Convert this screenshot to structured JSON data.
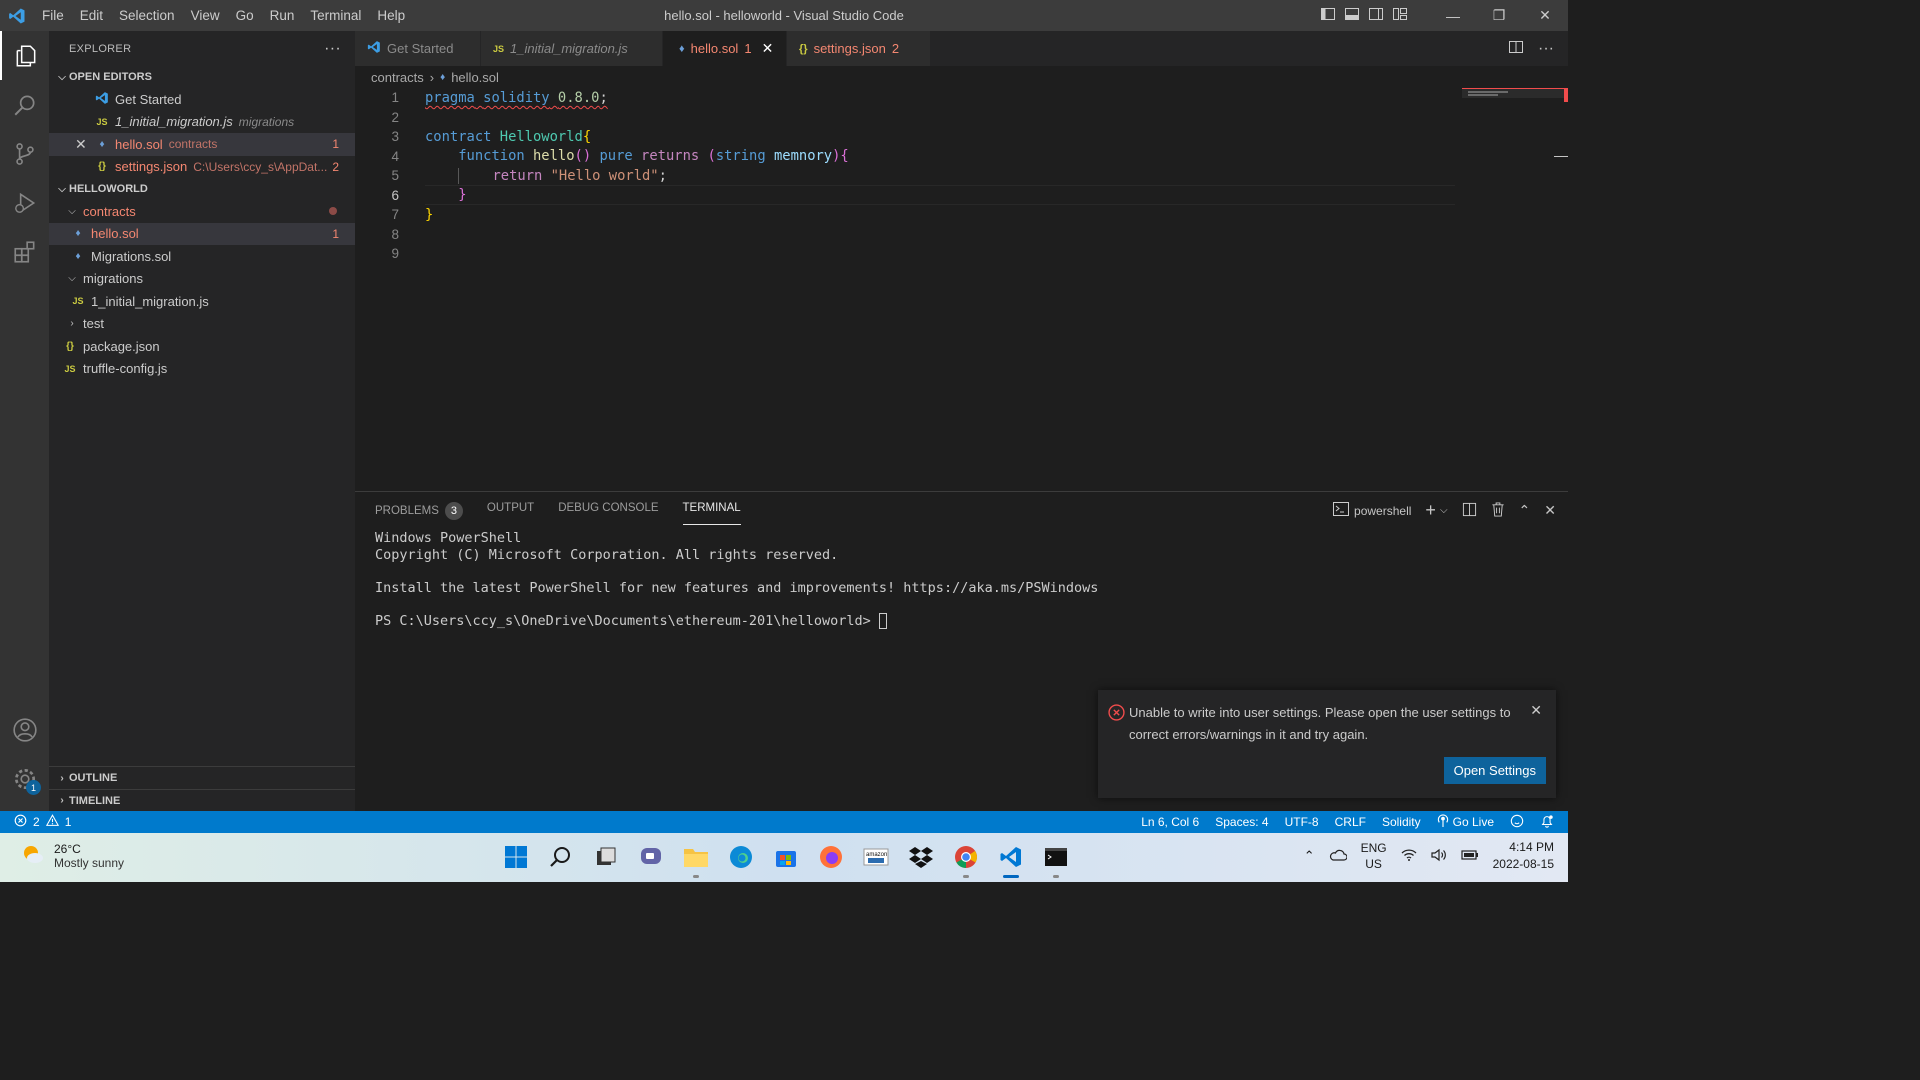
{
  "titlebar": {
    "menu": [
      "File",
      "Edit",
      "Selection",
      "View",
      "Go",
      "Run",
      "Terminal",
      "Help"
    ],
    "title": "hello.sol - helloworld - Visual Studio Code"
  },
  "sidebar": {
    "header": "EXPLORER",
    "open_editors_label": "OPEN EDITORS",
    "open_editors": [
      {
        "icon": "vscode-icon",
        "name": "Get Started",
        "desc": "",
        "count": ""
      },
      {
        "icon": "js-icon",
        "name": "1_initial_migration.js",
        "desc": "migrations",
        "count": ""
      },
      {
        "icon": "solidity-icon",
        "name": "hello.sol",
        "desc": "contracts",
        "count": "1"
      },
      {
        "icon": "json-icon",
        "name": "settings.json",
        "desc": "C:\\Users\\ccy_s\\AppDat...",
        "count": "2"
      }
    ],
    "project_label": "HELLOWORLD",
    "tree": [
      {
        "name": "contracts",
        "type": "folder"
      },
      {
        "name": "hello.sol",
        "type": "file",
        "count": "1"
      },
      {
        "name": "Migrations.sol",
        "type": "file"
      },
      {
        "name": "migrations",
        "type": "folder"
      },
      {
        "name": "1_initial_migration.js",
        "type": "file"
      },
      {
        "name": "test",
        "type": "folder"
      },
      {
        "name": "package.json",
        "type": "file"
      },
      {
        "name": "truffle-config.js",
        "type": "file"
      }
    ],
    "outline_label": "OUTLINE",
    "timeline_label": "TIMELINE"
  },
  "tabs": [
    {
      "label": "Get Started",
      "icon": "vscode-icon",
      "count": ""
    },
    {
      "label": "1_initial_migration.js",
      "icon": "js-icon",
      "count": ""
    },
    {
      "label": "hello.sol",
      "icon": "solidity-icon",
      "count": "1"
    },
    {
      "label": "settings.json",
      "icon": "json-icon",
      "count": "2"
    }
  ],
  "breadcrumb": {
    "folder": "contracts",
    "file": "hello.sol"
  },
  "editor": {
    "line_numbers": [
      "1",
      "2",
      "3",
      "4",
      "5",
      "6",
      "7",
      "8",
      "9"
    ],
    "lines": [
      "pragma solidity 0.8.0;",
      "",
      "contract Helloworld{",
      "    function hello() pure returns (string memnory){",
      "        return \"Hello world\";",
      "    }",
      "}",
      "",
      ""
    ]
  },
  "panel": {
    "tabs": [
      "PROBLEMS",
      "OUTPUT",
      "DEBUG CONSOLE",
      "TERMINAL"
    ],
    "problems_count": "3",
    "shell_label": "powershell",
    "terminal_lines": [
      "Windows PowerShell",
      "Copyright (C) Microsoft Corporation. All rights reserved.",
      "",
      "Install the latest PowerShell for new features and improvements! https://aka.ms/PSWindows",
      "",
      "PS C:\\Users\\ccy_s\\OneDrive\\Documents\\ethereum-201\\helloworld> "
    ]
  },
  "notification": {
    "message": "Unable to write into user settings. Please open the user settings to correct errors/warnings in it and try again.",
    "button": "Open Settings"
  },
  "statusbar": {
    "errors": "2",
    "warnings": "1",
    "position": "Ln 6, Col 6",
    "spaces": "Spaces: 4",
    "encoding": "UTF-8",
    "eol": "CRLF",
    "language": "Solidity",
    "golive": "Go Live"
  },
  "taskbar": {
    "temperature": "26°C",
    "weather": "Mostly sunny",
    "lang1": "ENG",
    "lang2": "US",
    "time": "4:14 PM",
    "date": "2022-08-15"
  },
  "colors": {
    "accent": "#007acc",
    "error": "#f48771",
    "activity_bar": "#333333",
    "sidebar": "#252526",
    "editor_bg": "#1e1e1e"
  }
}
